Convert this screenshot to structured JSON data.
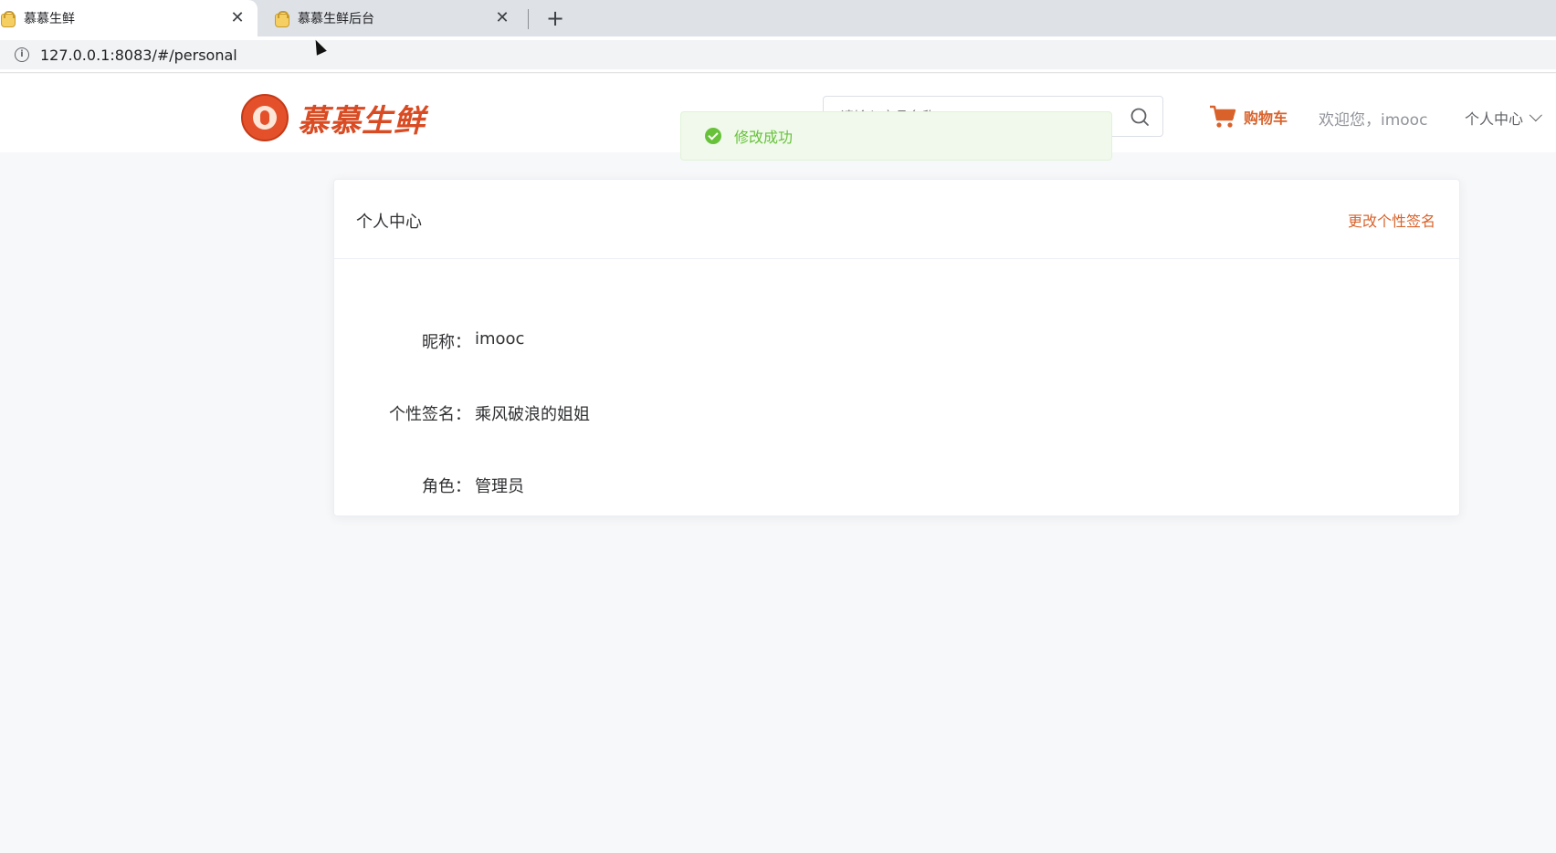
{
  "browser": {
    "tabs": [
      {
        "title": "慕慕生鲜",
        "active": true
      },
      {
        "title": "慕慕生鲜后台",
        "active": false
      }
    ],
    "url": "127.0.0.1:8083/#/personal"
  },
  "header": {
    "logo_text": "慕慕生鲜",
    "search_placeholder": "请输入商品名称",
    "cart_label": "购物车",
    "welcome": "欢迎您，imooc",
    "personal_menu": "个人中心"
  },
  "toast": {
    "message": "修改成功",
    "type": "success",
    "color": "#67c23a"
  },
  "card": {
    "title": "个人中心",
    "edit_link": "更改个性签名",
    "fields": [
      {
        "label": "昵称：",
        "value": "imooc"
      },
      {
        "label": "个性签名：",
        "value": "乘风破浪的姐姐"
      },
      {
        "label": "角色：",
        "value": "管理员"
      }
    ]
  },
  "colors": {
    "brand": "#d9622b",
    "page_bg": "#f7f8fa"
  }
}
